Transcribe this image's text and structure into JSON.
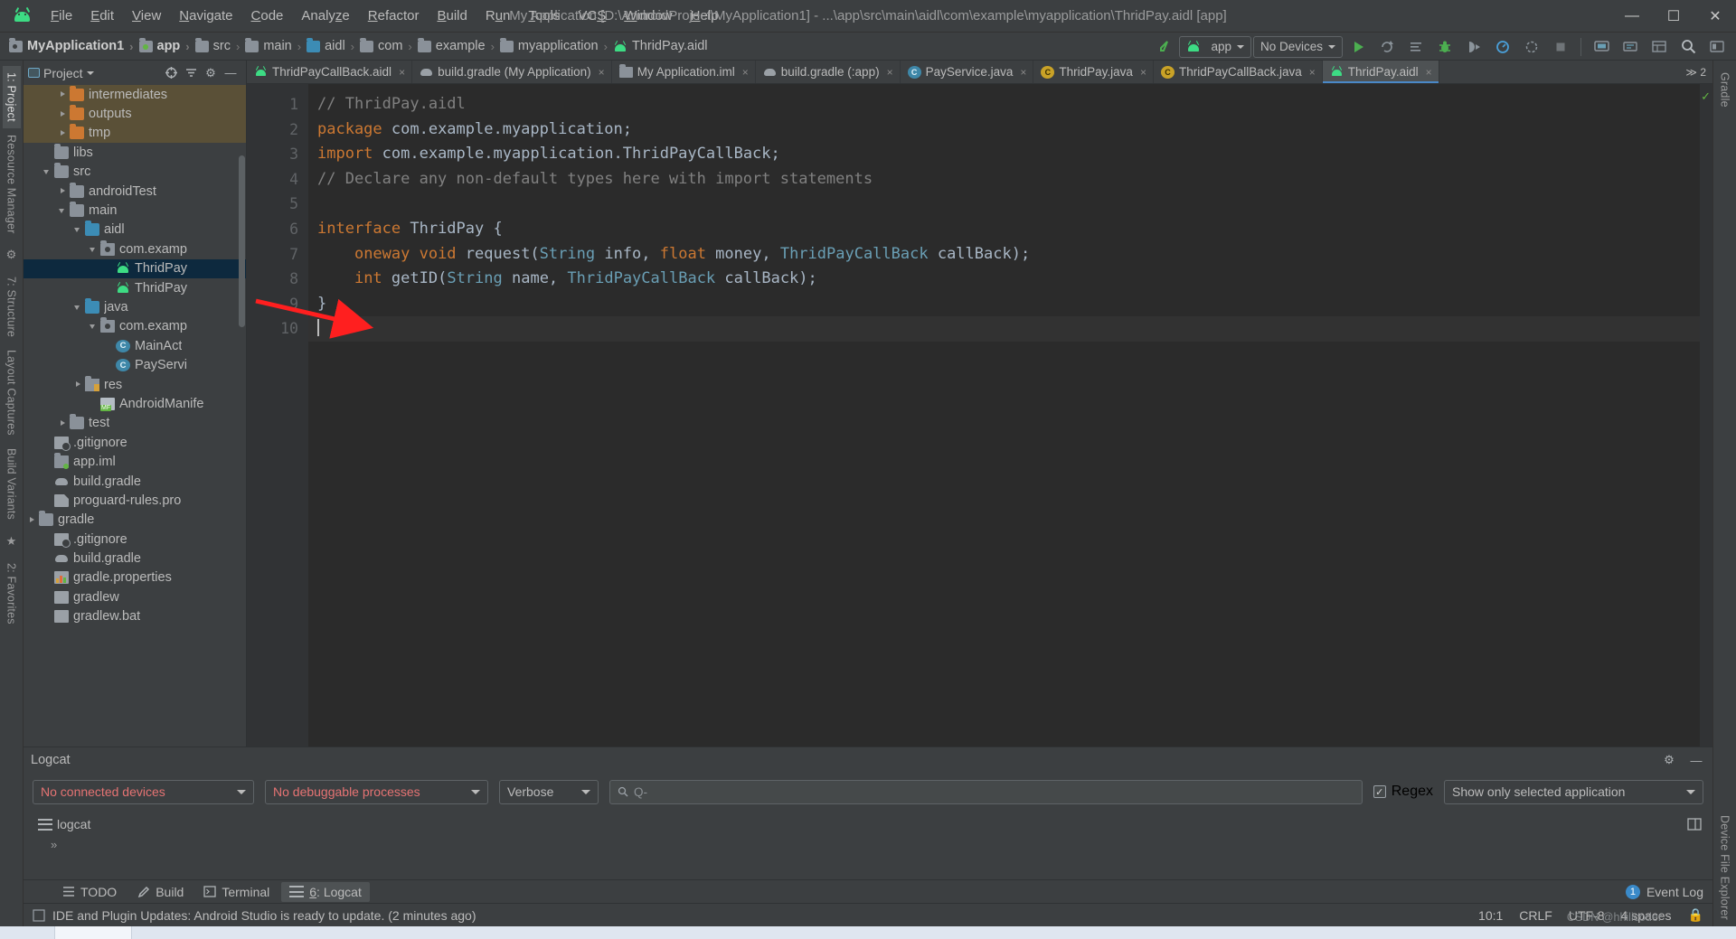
{
  "titlebar": {
    "app_icon": "android-logo-icon",
    "window_title": "My Application [D:\\AndroidProject\\MyApplication1] - ...\\app\\src\\main\\aidl\\com\\example\\myapplication\\ThridPay.aidl [app]",
    "menus": [
      "File",
      "Edit",
      "View",
      "Navigate",
      "Code",
      "Analyze",
      "Refactor",
      "Build",
      "Run",
      "Tools",
      "VCS",
      "Window",
      "Help"
    ],
    "controls": {
      "minimize": "—",
      "maximize": "❐",
      "close": "✕"
    }
  },
  "navbar": {
    "breadcrumbs": [
      {
        "label": "MyApplication1",
        "icon": "module-folder-icon"
      },
      {
        "label": "app",
        "icon": "module-folder-icon"
      },
      {
        "label": "src",
        "icon": "folder-icon"
      },
      {
        "label": "main",
        "icon": "folder-icon"
      },
      {
        "label": "aidl",
        "icon": "aidl-folder-icon"
      },
      {
        "label": "com",
        "icon": "package-icon"
      },
      {
        "label": "example",
        "icon": "package-icon"
      },
      {
        "label": "myapplication",
        "icon": "package-icon"
      },
      {
        "label": "ThridPay.aidl",
        "icon": "aidl-file-icon"
      }
    ],
    "separator": "›",
    "run_config": "app",
    "device": "No Devices",
    "buttons": [
      "make-project-icon",
      "run-icon",
      "apply-changes-icon",
      "apply-code-changes-icon",
      "debug-icon",
      "attach-debugger-icon",
      "profile-icon",
      "run-with-coverage-icon",
      "stop-icon",
      "avd-manager-icon",
      "sdk-manager-icon",
      "layout-inspector-icon",
      "search-everywhere-icon",
      "project-structure-icon"
    ]
  },
  "left_strip": {
    "tabs": [
      "1: Project",
      "Resource Manager",
      "7: Structure",
      "Layout Captures",
      "Build Variants",
      "2: Favorites"
    ],
    "active": "1: Project"
  },
  "right_strip": {
    "tabs": [
      "Gradle",
      "Device File Explorer"
    ]
  },
  "project_panel": {
    "title": "Project",
    "tools": [
      "target-icon",
      "collapse-all-icon",
      "settings-gear-icon",
      "hide-icon"
    ],
    "tree": [
      {
        "label": "intermediates",
        "depth": 4,
        "arrow": "right",
        "icon": "folder-orange",
        "highlight": true
      },
      {
        "label": "outputs",
        "depth": 4,
        "arrow": "right",
        "icon": "folder-orange",
        "highlight": true
      },
      {
        "label": "tmp",
        "depth": 4,
        "arrow": "right",
        "icon": "folder-orange",
        "highlight": true
      },
      {
        "label": "libs",
        "depth": 3,
        "arrow": "none",
        "icon": "folder-grey"
      },
      {
        "label": "src",
        "depth": 3,
        "arrow": "down",
        "icon": "folder-grey"
      },
      {
        "label": "androidTest",
        "depth": 4,
        "arrow": "right",
        "icon": "folder-grey"
      },
      {
        "label": "main",
        "depth": 4,
        "arrow": "down",
        "icon": "folder-grey"
      },
      {
        "label": "aidl",
        "depth": 5,
        "arrow": "down",
        "icon": "folder-blue"
      },
      {
        "label": "com.examp",
        "depth": 6,
        "arrow": "down",
        "icon": "package"
      },
      {
        "label": "ThridPay",
        "depth": 7,
        "arrow": "none",
        "icon": "aidl",
        "selected": true
      },
      {
        "label": "ThridPay",
        "depth": 7,
        "arrow": "none",
        "icon": "aidl"
      },
      {
        "label": "java",
        "depth": 5,
        "arrow": "down",
        "icon": "folder-blue"
      },
      {
        "label": "com.examp",
        "depth": 6,
        "arrow": "down",
        "icon": "package"
      },
      {
        "label": "MainAct",
        "depth": 7,
        "arrow": "none",
        "icon": "class"
      },
      {
        "label": "PayServi",
        "depth": 7,
        "arrow": "none",
        "icon": "class"
      },
      {
        "label": "res",
        "depth": 5,
        "arrow": "right",
        "icon": "res-folder"
      },
      {
        "label": "AndroidManife",
        "depth": 6,
        "arrow": "none",
        "icon": "manifest"
      },
      {
        "label": "test",
        "depth": 4,
        "arrow": "right",
        "icon": "folder-grey"
      },
      {
        "label": ".gitignore",
        "depth": 3,
        "arrow": "none",
        "icon": "gitignore"
      },
      {
        "label": "app.iml",
        "depth": 3,
        "arrow": "none",
        "icon": "iml"
      },
      {
        "label": "build.gradle",
        "depth": 3,
        "arrow": "none",
        "icon": "gradle"
      },
      {
        "label": "proguard-rules.pro",
        "depth": 3,
        "arrow": "none",
        "icon": "file"
      },
      {
        "label": "gradle",
        "depth": 2,
        "arrow": "right",
        "icon": "folder-grey"
      },
      {
        "label": ".gitignore",
        "depth": 3,
        "arrow": "none",
        "icon": "gitignore"
      },
      {
        "label": "build.gradle",
        "depth": 3,
        "arrow": "none",
        "icon": "gradle"
      },
      {
        "label": "gradle.properties",
        "depth": 3,
        "arrow": "none",
        "icon": "properties"
      },
      {
        "label": "gradlew",
        "depth": 3,
        "arrow": "none",
        "icon": "sh"
      },
      {
        "label": "gradlew.bat",
        "depth": 3,
        "arrow": "none",
        "icon": "sh"
      }
    ]
  },
  "editor": {
    "tabs": [
      {
        "label": "ThridPayCallBack.aidl",
        "icon": "aidl",
        "active": false
      },
      {
        "label": "build.gradle (My Application)",
        "icon": "gradle",
        "active": false
      },
      {
        "label": "My Application.iml",
        "icon": "iml",
        "active": false
      },
      {
        "label": "build.gradle (:app)",
        "icon": "gradle",
        "active": false
      },
      {
        "label": "PayService.java",
        "icon": "java-class",
        "active": false
      },
      {
        "label": "ThridPay.java",
        "icon": "java-gen",
        "active": false
      },
      {
        "label": "ThridPayCallBack.java",
        "icon": "java-gen",
        "active": false
      },
      {
        "label": "ThridPay.aidl",
        "icon": "aidl",
        "active": true
      }
    ],
    "tab_close": "×",
    "overflow_label": "≫ 2",
    "line_numbers": [
      "1",
      "2",
      "3",
      "4",
      "5",
      "6",
      "7",
      "8",
      "9",
      "10"
    ],
    "code_lines": [
      [
        {
          "t": "// ThridPay.aidl",
          "c": "cm"
        }
      ],
      [
        {
          "t": "package",
          "c": "kw"
        },
        {
          "t": " com.example.myapplication;",
          "c": "id"
        }
      ],
      [
        {
          "t": "import",
          "c": "kw"
        },
        {
          "t": " com.example.myapplication.ThridPayCallBack;",
          "c": "id"
        }
      ],
      [
        {
          "t": "// Declare any non-default types here with import statements",
          "c": "cm"
        }
      ],
      [
        {
          "t": "",
          "c": "id"
        }
      ],
      [
        {
          "t": "interface",
          "c": "kw"
        },
        {
          "t": " ThridPay {",
          "c": "id"
        }
      ],
      [
        {
          "t": "    ",
          "c": "id"
        },
        {
          "t": "oneway void",
          "c": "kw"
        },
        {
          "t": " request(",
          "c": "id"
        },
        {
          "t": "String",
          "c": "typ"
        },
        {
          "t": " info, ",
          "c": "id"
        },
        {
          "t": "float",
          "c": "kw"
        },
        {
          "t": " money, ",
          "c": "id"
        },
        {
          "t": "ThridPayCallBack",
          "c": "typ"
        },
        {
          "t": " callBack);",
          "c": "id"
        }
      ],
      [
        {
          "t": "    ",
          "c": "id"
        },
        {
          "t": "int",
          "c": "kw"
        },
        {
          "t": " getID(",
          "c": "id"
        },
        {
          "t": "String",
          "c": "typ"
        },
        {
          "t": " name, ",
          "c": "id"
        },
        {
          "t": "ThridPayCallBack",
          "c": "typ"
        },
        {
          "t": " callBack);",
          "c": "id"
        }
      ],
      [
        {
          "t": "}",
          "c": "id"
        }
      ],
      [
        {
          "t": "",
          "c": "id"
        }
      ]
    ],
    "annotation": {
      "type": "red-arrow",
      "points_to_line": 7,
      "color": "#ff1f1f"
    },
    "inspection_status": "ok-check-icon"
  },
  "logcat": {
    "title": "Logcat",
    "header_icons": [
      "settings-gear-icon",
      "hide-icon"
    ],
    "device_select": "No connected devices",
    "process_select": "No debuggable processes",
    "level_select": "Verbose",
    "search_placeholder": "Q-",
    "search_value": "",
    "regex_label": "Regex",
    "regex_checked": true,
    "regex_check_glyph": "✓",
    "filter_select": "Show only selected application",
    "tab_label": "logcat",
    "right_icons": [
      "split-panel-icon"
    ]
  },
  "toolwindow_bar": {
    "items": [
      {
        "label": "TODO",
        "icon": "todo-icon",
        "active": false
      },
      {
        "label": "Build",
        "icon": "build-hammer-icon",
        "active": false
      },
      {
        "label": "Terminal",
        "icon": "terminal-icon",
        "active": false
      },
      {
        "label": "6: Logcat",
        "icon": "logcat-icon",
        "active": true,
        "mnemonic": "6"
      }
    ],
    "right": {
      "badge": "1",
      "label": "Event Log"
    }
  },
  "statusbar": {
    "message": "IDE and Plugin Updates: Android Studio is ready to update. (2 minutes ago)",
    "message_icon": "info-icon",
    "caret_position": "10:1",
    "line_separator": "CRLF",
    "encoding": "UTF-8",
    "indent": "4 spaces",
    "watermark": "CSDN @hhilicoder"
  }
}
